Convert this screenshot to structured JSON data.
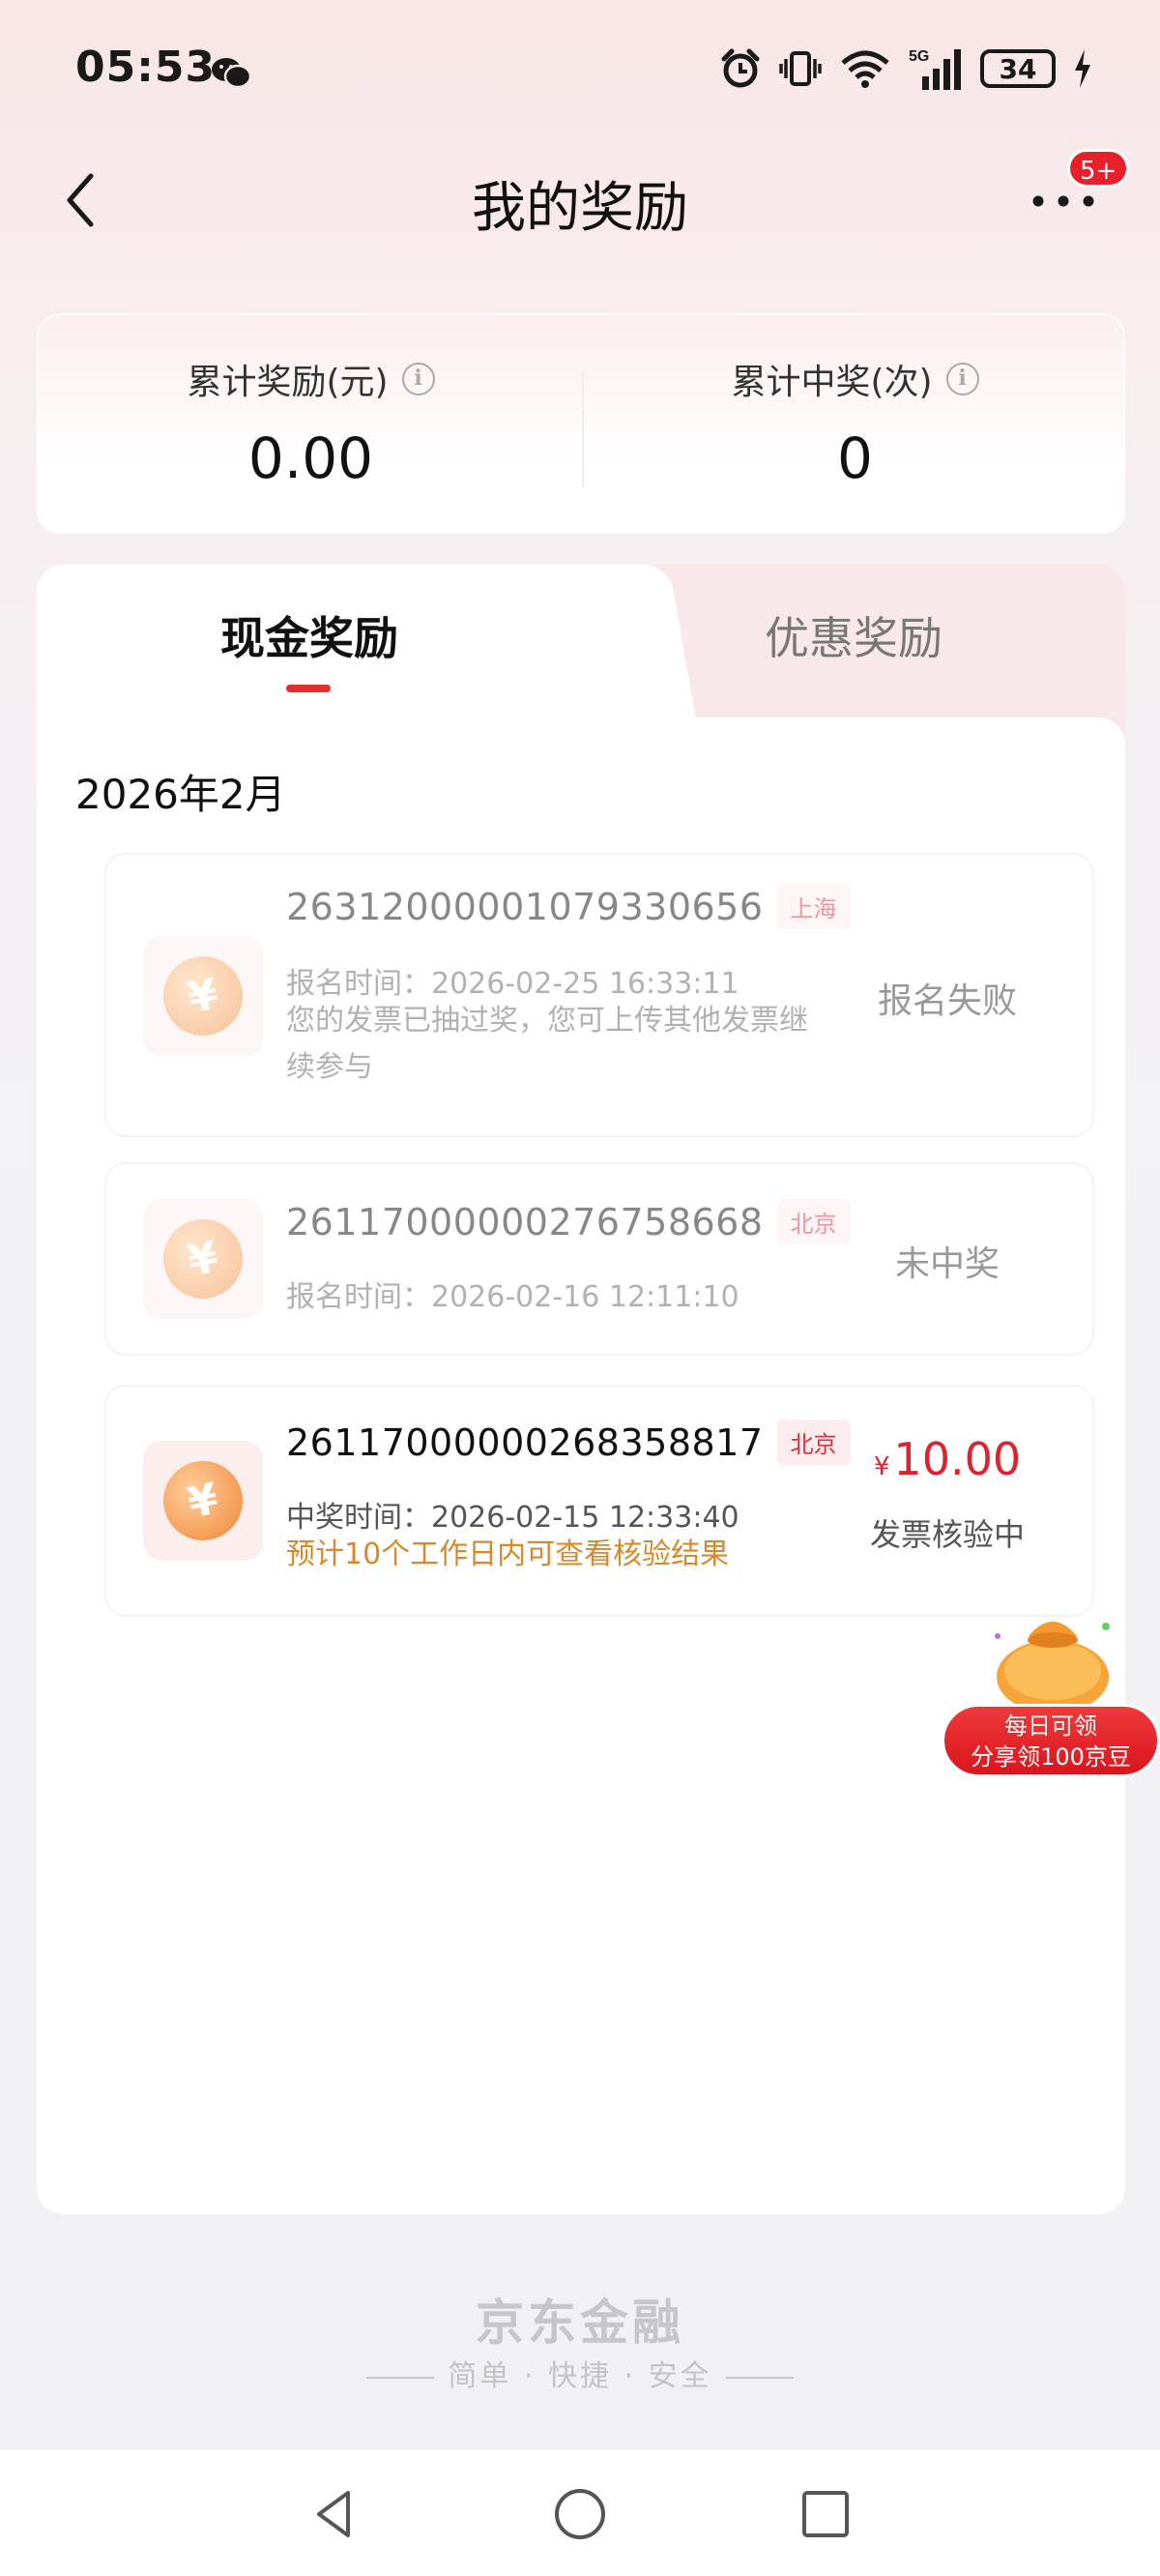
{
  "status_bar": {
    "time": "05:53",
    "battery": "34",
    "network": "5G",
    "icons": [
      "wechat-icon",
      "alarm-icon",
      "vibrate-icon",
      "wifi-icon",
      "signal-icon",
      "battery-icon",
      "charging-icon"
    ]
  },
  "nav": {
    "title": "我的奖励",
    "badge": "5+"
  },
  "summary": {
    "total_reward_label": "累计奖励(元)",
    "total_reward_value": "0.00",
    "total_wins_label": "累计中奖(次)",
    "total_wins_value": "0"
  },
  "tabs": {
    "cash": "现金奖励",
    "coupon": "优惠奖励",
    "active": "cash"
  },
  "month": "2026年2月",
  "records": [
    {
      "id": "26312000001079330656",
      "city": "上海",
      "time_label": "报名时间：",
      "time": "2026-02-25 16:33:11",
      "note": "您的发票已抽过奖，您可上传其他发票继续参与",
      "status": "报名失败"
    },
    {
      "id": "26117000000276758668",
      "city": "北京",
      "time_label": "报名时间：",
      "time": "2026-02-16 12:11:10",
      "status": "未中奖"
    },
    {
      "id": "26117000000268358817",
      "city": "北京",
      "time_label": "中奖时间：",
      "time": "2026-02-15 12:33:40",
      "note": "预计10个工作日内可查看核验结果",
      "currency": "¥",
      "amount": "10.00",
      "status": "发票核验中"
    }
  ],
  "promo": {
    "line1": "每日可领",
    "line2": "分享领100京豆"
  },
  "footer": {
    "brand": "京东金融",
    "slogan": "简单 · 快捷 · 安全"
  },
  "colors": {
    "accent_red": "#e0222e",
    "note_orange": "#d9892a",
    "tab_underline": "#e52d2d"
  }
}
